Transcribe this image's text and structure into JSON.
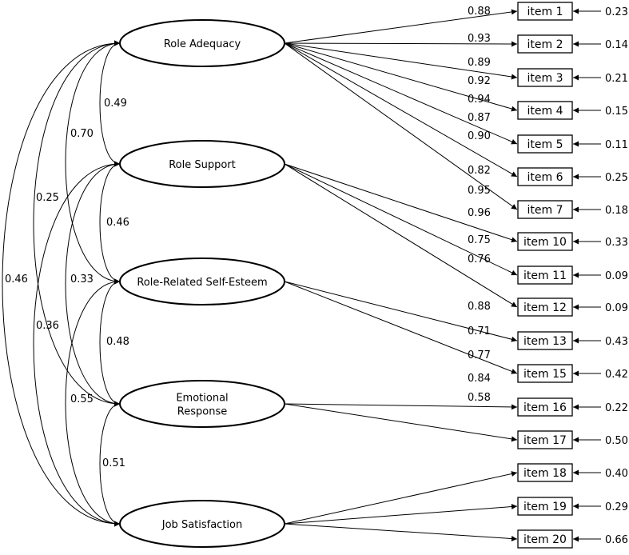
{
  "factors": [
    {
      "id": "RA",
      "label_lines": [
        "Role Adequacy"
      ]
    },
    {
      "id": "RS",
      "label_lines": [
        "Role Support"
      ]
    },
    {
      "id": "RRSE",
      "label_lines": [
        "Role-Related Self-Esteem"
      ]
    },
    {
      "id": "ER",
      "label_lines": [
        "Emotional",
        "Response"
      ]
    },
    {
      "id": "JS",
      "label_lines": [
        "Job Satisfaction"
      ]
    }
  ],
  "items": [
    {
      "label": "item 1",
      "factor": "RA",
      "loading": "0.88",
      "error": "0.23"
    },
    {
      "label": "item 2",
      "factor": "RA",
      "loading": "0.93",
      "error": "0.14"
    },
    {
      "label": "item 3",
      "factor": "RA",
      "loading": "0.89",
      "error": "0.21"
    },
    {
      "label": "item 4",
      "factor": "RA",
      "loading": "0.92",
      "error": "0.15"
    },
    {
      "label": "item 5",
      "factor": "RA",
      "loading": "0.94",
      "error": "0.11"
    },
    {
      "label": "item 6",
      "factor": "RA",
      "loading": "0.87",
      "error": "0.25"
    },
    {
      "label": "item 7",
      "factor": "RA",
      "loading": "0.90",
      "error": "0.18"
    },
    {
      "label": "item 10",
      "factor": "RS",
      "loading": "0.82",
      "error": "0.33"
    },
    {
      "label": "item 11",
      "factor": "RS",
      "loading": "0.95",
      "error": "0.09"
    },
    {
      "label": "item 12",
      "factor": "RS",
      "loading": "0.96",
      "error": "0.09"
    },
    {
      "label": "item 13",
      "factor": "RRSE",
      "loading": "0.75",
      "error": "0.43"
    },
    {
      "label": "item 15",
      "factor": "RRSE",
      "loading": "0.76",
      "error": "0.42"
    },
    {
      "label": "item 16",
      "factor": "ER",
      "loading": "0.88",
      "error": "0.22"
    },
    {
      "label": "item 17",
      "factor": "ER",
      "loading": "0.71",
      "error": "0.50"
    },
    {
      "label": "item 18",
      "factor": "JS",
      "loading": "0.77",
      "error": "0.40"
    },
    {
      "label": "item 19",
      "factor": "JS",
      "loading": "0.84",
      "error": "0.29"
    },
    {
      "label": "item 20",
      "factor": "JS",
      "loading": "0.58",
      "error": "0.66"
    }
  ],
  "correlations": [
    {
      "from": "RA",
      "to": "RS",
      "value": "0.49"
    },
    {
      "from": "RS",
      "to": "RRSE",
      "value": "0.46"
    },
    {
      "from": "RRSE",
      "to": "ER",
      "value": "0.48"
    },
    {
      "from": "ER",
      "to": "JS",
      "value": "0.51"
    },
    {
      "from": "RA",
      "to": "RRSE",
      "value": "0.70"
    },
    {
      "from": "RS",
      "to": "ER",
      "value": "0.33"
    },
    {
      "from": "RRSE",
      "to": "JS",
      "value": "0.55"
    },
    {
      "from": "RA",
      "to": "ER",
      "value": "0.25"
    },
    {
      "from": "RS",
      "to": "JS",
      "value": "0.36"
    },
    {
      "from": "RA",
      "to": "JS",
      "value": "0.46"
    }
  ]
}
